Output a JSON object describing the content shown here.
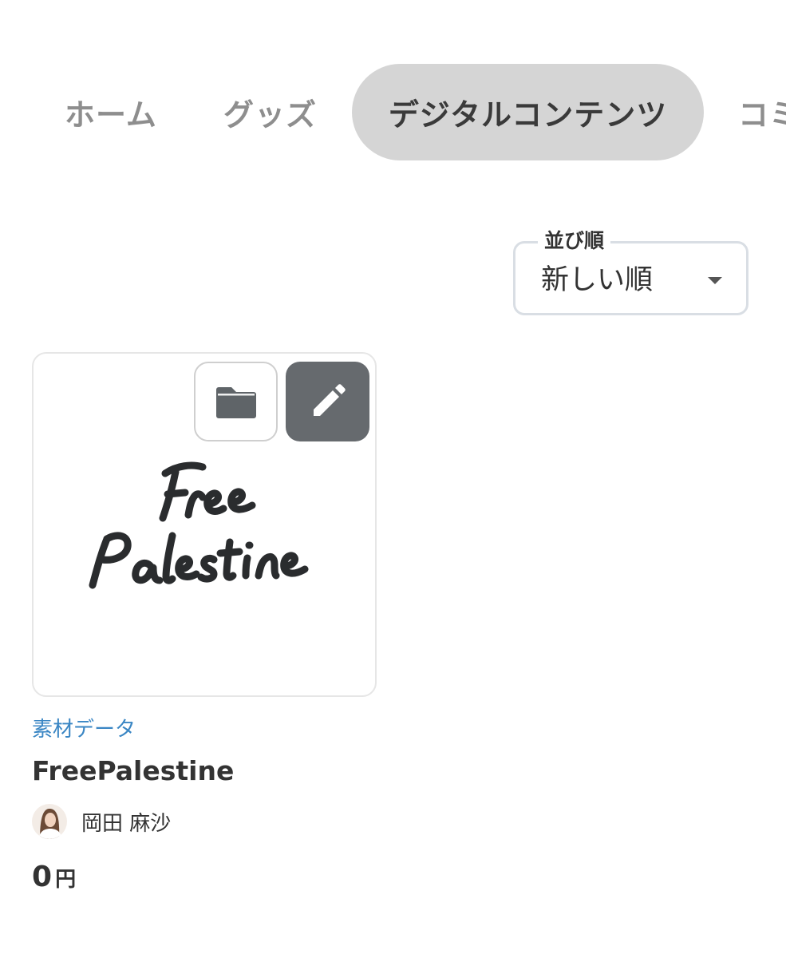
{
  "tabs": [
    {
      "label": "ホーム",
      "active": false
    },
    {
      "label": "グッズ",
      "active": false
    },
    {
      "label": "デジタルコンテンツ",
      "active": true
    },
    {
      "label": "コミ",
      "active": false
    }
  ],
  "sort": {
    "legend": "並び順",
    "value": "新しい順"
  },
  "product": {
    "artwork_lines": [
      "Free",
      "Palestine"
    ],
    "category": "素材データ",
    "title": "FreePalestine",
    "creator": "岡田 麻沙",
    "price": "0",
    "currency": "円"
  },
  "icons": {
    "folder": "folder-icon",
    "edit": "pencil-icon",
    "dropdown": "caret-down-icon"
  },
  "colors": {
    "active_tab_bg": "#d5d5d5",
    "inactive_tab_text": "#8e8e8e",
    "category_link": "#3a86c4",
    "edit_button_bg": "#666a6e"
  }
}
